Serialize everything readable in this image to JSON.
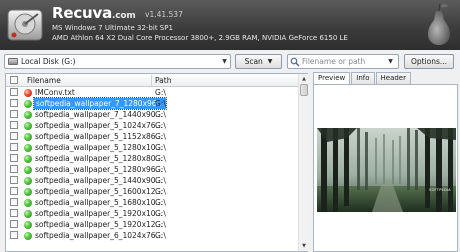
{
  "app": {
    "name": "Recuva",
    "domain": ".com",
    "version": "v1.41.537",
    "system_line1": "MS Windows 7 Ultimate 32-bit SP1",
    "system_line2": "AMD Athlon 64 X2 Dual Core Processor 3800+, 2.9GB RAM, NVIDIA GeForce 6150 LE"
  },
  "toolbar": {
    "drive": "Local Disk (G:)",
    "scan_label": "Scan",
    "filter_placeholder": "Filename or path",
    "options_label": "Options..."
  },
  "file_list": {
    "columns": {
      "filename": "Filename",
      "path": "Path"
    },
    "rows": [
      {
        "name": "IMConv.txt",
        "path": "G:\\",
        "status": "red",
        "selected": false
      },
      {
        "name": "softpedia_wallpaper_7_1280x96...",
        "path": "G:\\",
        "status": "green",
        "selected": true
      },
      {
        "name": "softpedia_wallpaper_7_1440x90...",
        "path": "G:\\",
        "status": "green",
        "selected": false
      },
      {
        "name": "softpedia_wallpaper_5_1024x76...",
        "path": "G:\\",
        "status": "green",
        "selected": false
      },
      {
        "name": "softpedia_wallpaper_5_1152x86...",
        "path": "G:\\",
        "status": "green",
        "selected": false
      },
      {
        "name": "softpedia_wallpaper_5_1280x10...",
        "path": "G:\\",
        "status": "green",
        "selected": false
      },
      {
        "name": "softpedia_wallpaper_5_1280x80...",
        "path": "G:\\",
        "status": "green",
        "selected": false
      },
      {
        "name": "softpedia_wallpaper_5_1280x96...",
        "path": "G:\\",
        "status": "green",
        "selected": false
      },
      {
        "name": "softpedia_wallpaper_5_1440x90...",
        "path": "G:\\",
        "status": "green",
        "selected": false
      },
      {
        "name": "softpedia_wallpaper_5_1600x12...",
        "path": "G:\\",
        "status": "green",
        "selected": false
      },
      {
        "name": "softpedia_wallpaper_5_1680x10...",
        "path": "G:\\",
        "status": "green",
        "selected": false
      },
      {
        "name": "softpedia_wallpaper_5_1920x10...",
        "path": "G:\\",
        "status": "green",
        "selected": false
      },
      {
        "name": "softpedia_wallpaper_5_1920x12...",
        "path": "G:\\",
        "status": "green",
        "selected": false
      },
      {
        "name": "softpedia_wallpaper_6_1024x76...",
        "path": "G:\\",
        "status": "green",
        "selected": false
      }
    ]
  },
  "preview": {
    "tabs": [
      "Preview",
      "Info",
      "Header"
    ],
    "active_tab": "Preview",
    "image_caption": "SOFTPEDIA"
  },
  "colors": {
    "header_bg": "#3d3d3d",
    "selection": "#3399ff",
    "status_green": "#4cc33a",
    "status_red": "#f24a2c"
  }
}
